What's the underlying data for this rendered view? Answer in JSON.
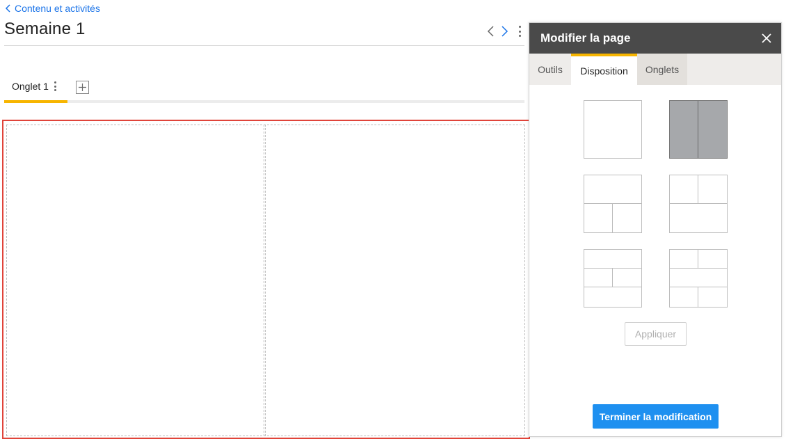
{
  "header": {
    "back_label": "Contenu et activités",
    "page_title": "Semaine 1"
  },
  "tabs": [
    {
      "label": "Onglet 1",
      "active": true
    }
  ],
  "panel": {
    "title": "Modifier la page",
    "tabs": [
      {
        "label": "Outils",
        "active": false
      },
      {
        "label": "Disposition",
        "active": true
      },
      {
        "label": "Onglets",
        "active": false
      }
    ],
    "layouts": [
      {
        "id": "one-column",
        "selected": false
      },
      {
        "id": "two-columns",
        "selected": true
      },
      {
        "id": "one-top-two-bottom",
        "selected": false
      },
      {
        "id": "two-top-one-bottom",
        "selected": false
      },
      {
        "id": "one-two-one",
        "selected": false
      },
      {
        "id": "two-one-two",
        "selected": false
      }
    ],
    "apply_label": "Appliquer",
    "finish_label": "Terminer la modification"
  },
  "colors": {
    "accent": "#f7b500",
    "link": "#1a73e8",
    "primary_button": "#1e90f0",
    "selection_border": "#e0443a",
    "panel_header": "#4a4a4a"
  }
}
